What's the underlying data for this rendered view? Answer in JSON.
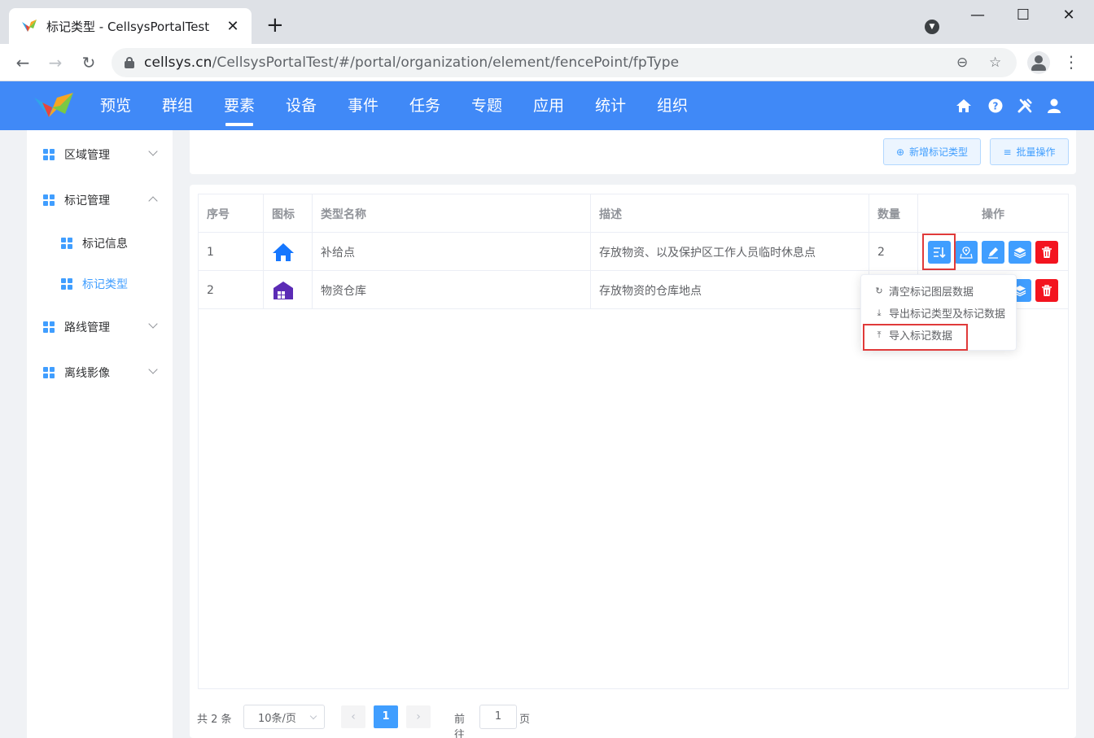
{
  "browser": {
    "tab_title": "标记类型 - CellsysPortalTest",
    "url_domain": "cellsys.cn",
    "url_path": "/CellsysPortalTest/#/portal/organization/element/fencePoint/fpType"
  },
  "topnav": {
    "items": [
      "预览",
      "群组",
      "要素",
      "设备",
      "事件",
      "任务",
      "专题",
      "应用",
      "统计",
      "组织"
    ],
    "active": "要素"
  },
  "sidebar": {
    "region": "区域管理",
    "marker": "标记管理",
    "marker_info": "标记信息",
    "marker_type": "标记类型",
    "route": "路线管理",
    "offline": "离线影像"
  },
  "actions": {
    "add_label": "新增标记类型",
    "batch_label": "批量操作"
  },
  "table": {
    "headers": [
      "序号",
      "图标",
      "类型名称",
      "描述",
      "数量",
      "操作"
    ],
    "rows": [
      {
        "index": "1",
        "icon": "home-icon",
        "icon_color": "#1677ff",
        "name": "补给点",
        "desc": "存放物资、以及保护区工作人员临时休息点",
        "count": "2"
      },
      {
        "index": "2",
        "icon": "warehouse-icon",
        "icon_color": "#5b2bb5",
        "name": "物资仓库",
        "desc": "存放物资的仓库地点",
        "count": ""
      }
    ]
  },
  "dropdown": {
    "items": [
      "清空标记图层数据",
      "导出标记类型及标记数据",
      "导入标记数据"
    ]
  },
  "pagination": {
    "total": "共 2 条",
    "page_size": "10条/页",
    "current": "1",
    "goto_label": "前往",
    "goto_value": "1",
    "unit": "页"
  },
  "colors": {
    "primary": "#409eff",
    "header": "#4089f7",
    "danger": "#f3141f",
    "highlight": "#e03a3a"
  }
}
